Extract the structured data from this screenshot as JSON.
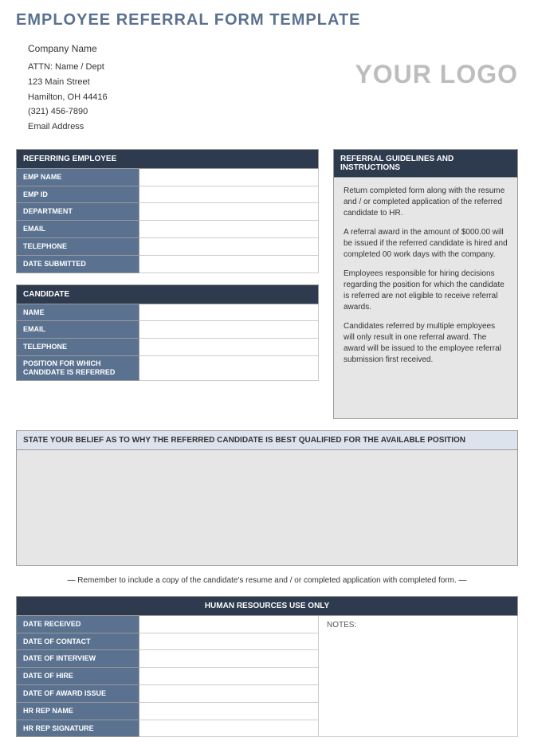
{
  "title": "EMPLOYEE REFERRAL FORM TEMPLATE",
  "company": {
    "name": "Company Name",
    "attn": "ATTN: Name / Dept",
    "street": "123 Main Street",
    "city_line": "Hamilton, OH  44416",
    "phone": "(321) 456-7890",
    "email": "Email Address"
  },
  "logo_text": "YOUR LOGO",
  "referring_employee": {
    "header": "REFERRING EMPLOYEE",
    "fields": {
      "emp_name": "EMP NAME",
      "emp_id": "EMP ID",
      "department": "DEPARTMENT",
      "email": "EMAIL",
      "telephone": "TELEPHONE",
      "date_submitted": "DATE SUBMITTED"
    }
  },
  "candidate": {
    "header": "CANDIDATE",
    "fields": {
      "name": "NAME",
      "email": "EMAIL",
      "telephone": "TELEPHONE",
      "position": "POSITION FOR WHICH CANDIDATE IS REFERRED"
    }
  },
  "guidelines": {
    "header": "REFERRAL GUIDELINES AND INSTRUCTIONS",
    "p1": "Return completed form along with the resume and / or completed application of the referred candidate to HR.",
    "p2": "A referral award in the amount of $000.00 will be issued if the referred candidate is hired and completed 00 work days with the company.",
    "p3": "Employees responsible for hiring decisions regarding the position for which the candidate is referred are not eligible to receive referral awards.",
    "p4": "Candidates referred by multiple employees will only result in one referral award.  The award will be issued to the employee referral submission first received."
  },
  "belief_header": "STATE YOUR BELIEF AS TO WHY THE REFERRED CANDIDATE IS BEST QUALIFIED FOR THE AVAILABLE POSITION",
  "reminder": "— Remember to include a copy of the candidate's resume and / or completed application with completed form. —",
  "hr": {
    "header": "HUMAN RESOURCES USE ONLY",
    "notes_label": "NOTES:",
    "fields": {
      "date_received": "DATE RECEIVED",
      "date_contact": "DATE OF CONTACT",
      "date_interview": "DATE OF INTERVIEW",
      "date_hire": "DATE OF HIRE",
      "date_award": "DATE OF AWARD ISSUE",
      "rep_name": "HR REP NAME",
      "rep_signature": "HR REP SIGNATURE"
    }
  }
}
